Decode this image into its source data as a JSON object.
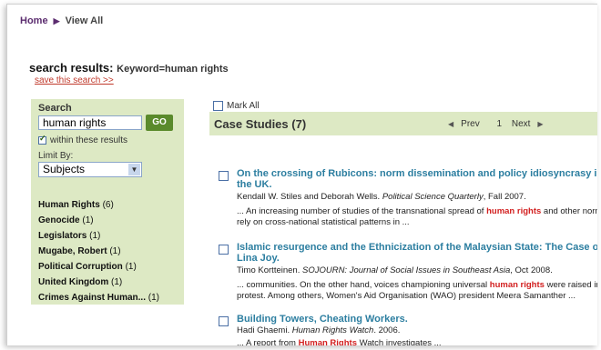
{
  "breadcrumb": {
    "home": "Home",
    "current": "View All"
  },
  "header": {
    "label": "search results:",
    "keyword": "Keyword=human rights",
    "save_link": "save this search >>"
  },
  "sidebar": {
    "heading": "Search",
    "search_value": "human rights",
    "go_label": "GO",
    "within_label": "within these results",
    "limit_label": "Limit By:",
    "limit_value": "Subjects",
    "facets": [
      {
        "name": "Human Rights",
        "count": "(6)"
      },
      {
        "name": "Genocide",
        "count": "(1)"
      },
      {
        "name": "Legislators",
        "count": "(1)"
      },
      {
        "name": "Mugabe, Robert",
        "count": "(1)"
      },
      {
        "name": "Political Corruption",
        "count": "(1)"
      },
      {
        "name": "United Kingdom",
        "count": "(1)"
      },
      {
        "name": "Crimes Against Human...",
        "count": "(1)"
      }
    ]
  },
  "results": {
    "mark_all": "Mark All",
    "section_title": "Case Studies (7)",
    "pager": {
      "prev": "Prev",
      "page": "1",
      "next": "Next"
    },
    "items": [
      {
        "title": "On the crossing of Rubicons: norm dissemination and policy idiosyncrasy in the UK.",
        "authors": "Kendall W. Stiles and Deborah Wells.",
        "source": "Political Science Quarterly",
        "date": ", Fall 2007.",
        "snip_a": "... An increasing number of studies of the transnational spread of ",
        "snip_hl": "human rights",
        "snip_b": " and other norms rely on cross-national statistical patterns in ..."
      },
      {
        "title": "Islamic resurgence and the Ethnicization of the Malaysian State: The Case of Lina Joy.",
        "authors": "Timo Kortteinen.",
        "source": "SOJOURN: Journal of Social Issues in Southeast Asia",
        "date": ", Oct 2008.",
        "snip_a": "... communities. On the other hand, voices championing universal ",
        "snip_hl": "human rights",
        "snip_b": " were raised in protest. Among others, Women's Aid Organisation (WAO) president Meera Samanther ..."
      },
      {
        "title": "Building Towers, Cheating Workers.",
        "authors": "Hadi Ghaemi.",
        "source": "Human Rights Watch",
        "date": ". 2006.",
        "snip_a": "... A report from ",
        "snip_hl": "Human Rights",
        "snip_b": " Watch investigates ..."
      }
    ]
  }
}
